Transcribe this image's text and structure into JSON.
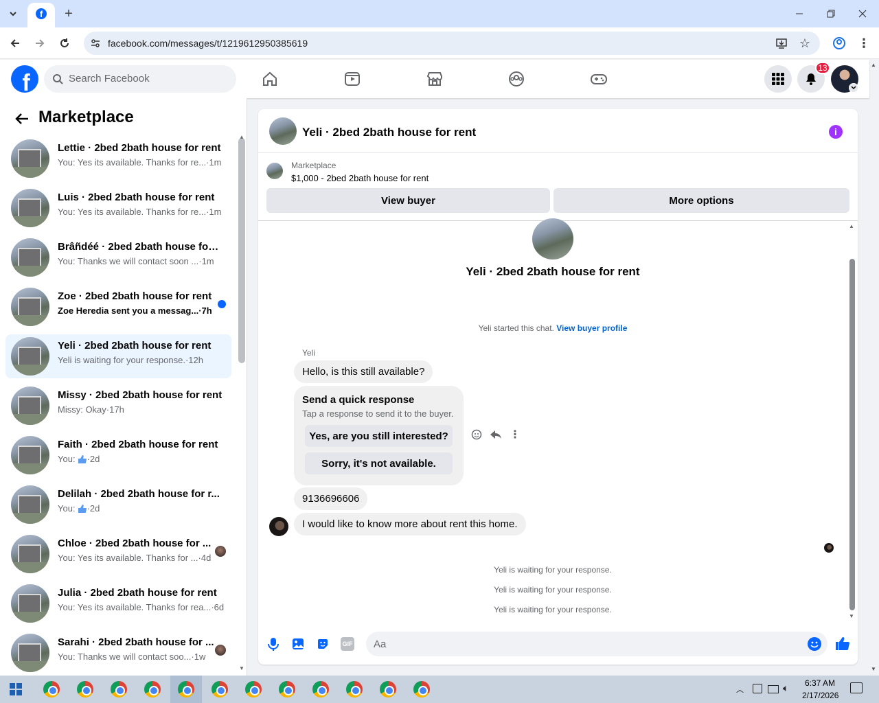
{
  "browser": {
    "url": "facebook.com/messages/t/1219612950385619"
  },
  "facebook": {
    "search_placeholder": "Search Facebook",
    "notification_count": "13"
  },
  "sidebar": {
    "title": "Marketplace",
    "threads": [
      {
        "title": "Lettie · 2bed 2bath house for rent",
        "preview": "You: Yes its available. Thanks for re...",
        "time": "·1m"
      },
      {
        "title": "Luis · 2bed 2bath house for rent",
        "preview": "You: Yes its available. Thanks for re...",
        "time": "·1m"
      },
      {
        "title": "Brâñdéé · 2bed 2bath house for ...",
        "preview": "You: Thanks we will contact soon ...",
        "time": "·1m"
      },
      {
        "title": "Zoe · 2bed 2bath house for rent",
        "preview": "Zoe Heredia sent you a messag...",
        "time": "·7h"
      },
      {
        "title": "Yeli · 2bed 2bath house for rent",
        "preview": "Yeli is waiting for your response.",
        "time": "·12h"
      },
      {
        "title": "Missy · 2bed 2bath house for rent",
        "preview": "Missy: Okay",
        "time": "·17h"
      },
      {
        "title": "Faith · 2bed 2bath house for rent",
        "preview": "You:",
        "time": "·2d"
      },
      {
        "title": "Delilah · 2bed 2bath house for r...",
        "preview": "You:",
        "time": "·2d"
      },
      {
        "title": "Chloe · 2bed 2bath house for ...",
        "preview": "You: Yes its available. Thanks for ...",
        "time": "·4d"
      },
      {
        "title": "Julia · 2bed 2bath house for rent",
        "preview": "You: Yes its available. Thanks for rea...",
        "time": "·6d"
      },
      {
        "title": "Sarahi · 2bed 2bath house for ...",
        "preview": "You: Thanks we will contact soo...",
        "time": "·1w"
      }
    ]
  },
  "chat": {
    "title": "Yeli · 2bed 2bath house for rent",
    "marketplace_label": "Marketplace",
    "listing": "$1,000 - 2bed 2bath house for rent",
    "view_buyer": "View buyer",
    "more_options": "More options",
    "hero_name": "Yeli · 2bed 2bath house for rent",
    "started_text": "Yeli started this chat.",
    "view_buyer_profile": "View buyer profile",
    "sender": "Yeli",
    "msg1": "Hello, is this still available?",
    "quick_title": "Send a quick response",
    "quick_sub": "Tap a response to send it to the buyer.",
    "quick_opt1": "Yes, are you still interested?",
    "quick_opt2": "Sorry, it's not available.",
    "msg2": "9136696606",
    "msg3": "I would like to know more about rent this home.",
    "waiting": [
      "Yeli is waiting for your response.",
      "Yeli is waiting for your response.",
      "Yeli is waiting for your response."
    ],
    "composer_placeholder": "Aa"
  },
  "taskbar": {
    "time": "6:37 AM",
    "date": "2/17/2026"
  },
  "colors": {
    "brand": "#0866ff",
    "badge": "#e41e3f",
    "info": "#a033ff"
  }
}
